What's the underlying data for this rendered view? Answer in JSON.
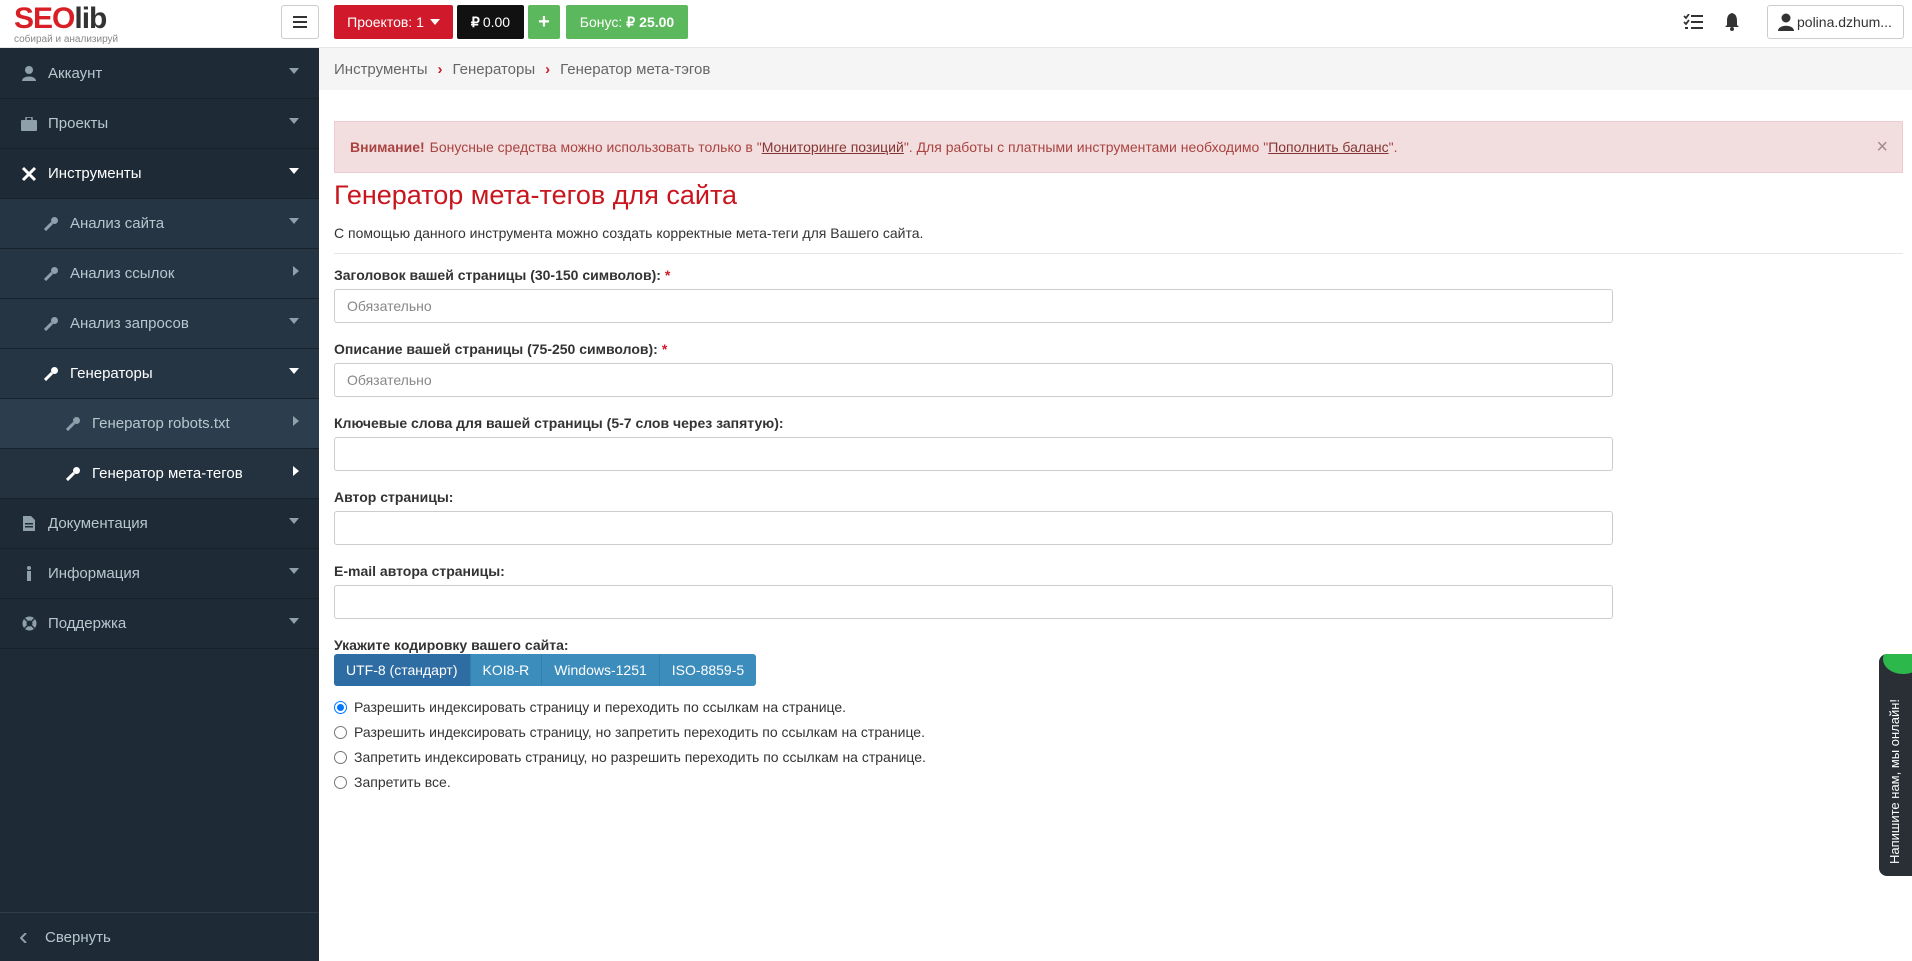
{
  "logo": {
    "word_a": "SEO",
    "word_b": "lib",
    "tagline": "собирай и анализируй"
  },
  "header": {
    "projects_label": "Проектов: 1",
    "balance_value": "0.00",
    "plus_label": "+",
    "bonus_label": "Бонус:",
    "bonus_value": "25.00",
    "user_name": "polina.dzhum..."
  },
  "sidebar": {
    "items": [
      {
        "label": "Аккаунт"
      },
      {
        "label": "Проекты"
      },
      {
        "label": "Инструменты"
      },
      {
        "label": "Анализ сайта"
      },
      {
        "label": "Анализ ссылок"
      },
      {
        "label": "Анализ запросов"
      },
      {
        "label": "Генераторы"
      },
      {
        "label": "Генератор robots.txt"
      },
      {
        "label": "Генератор мета-тегов"
      },
      {
        "label": "Документация"
      },
      {
        "label": "Информация"
      },
      {
        "label": "Поддержка"
      }
    ],
    "collapse_label": "Свернуть"
  },
  "breadcrumb": [
    "Инструменты",
    "Генераторы",
    "Генератор мета-тэгов"
  ],
  "alert": {
    "strong": "Внимание!",
    "text1": "Бонусные средства можно использовать только в \"",
    "link1": "Мониторинге позиций",
    "text2": "\". Для работы с платными инструментами необходимо \"",
    "link2": "Пополнить баланс",
    "text3": "\".",
    "close": "×"
  },
  "page": {
    "title": "Генератор мета-тегов для сайта",
    "description": "С помощью данного инструмента можно создать корректные мета-теги для Вашего сайта."
  },
  "form": {
    "title_label": "Заголовок вашей страницы (30-150 символов):",
    "title_placeholder": "Обязательно",
    "desc_label": "Описание вашей страницы (75-250 символов):",
    "desc_placeholder": "Обязательно",
    "keywords_label": "Ключевые слова для вашей страницы (5-7 слов через запятую):",
    "author_label": "Автор страницы:",
    "email_label": "E-mail автора страницы:",
    "encoding_label": "Укажите кодировку вашего сайта:",
    "required_mark": "*",
    "encodings": [
      "UTF-8 (стандарт)",
      "KOI8-R",
      "Windows-1251",
      "ISO-8859-5"
    ],
    "encoding_selected": "UTF-8 (стандарт)",
    "robots_options": [
      "Разрешить индексировать страницу и переходить по ссылкам на странице.",
      "Разрешить индексировать страницу, но запретить переходить по ссылкам на странице.",
      "Запретить индексировать страницу, но разрешить переходить по ссылкам на странице.",
      "Запретить все."
    ],
    "robots_selected": "Разрешить индексировать страницу и переходить по ссылкам на странице."
  },
  "chat": {
    "label": "Напишите нам, мы онлайн!"
  },
  "colors": {
    "accent": "#d0192a",
    "sidebar": "#1e2b37",
    "green": "#5cb85c",
    "blue": "#3c8dbc"
  }
}
